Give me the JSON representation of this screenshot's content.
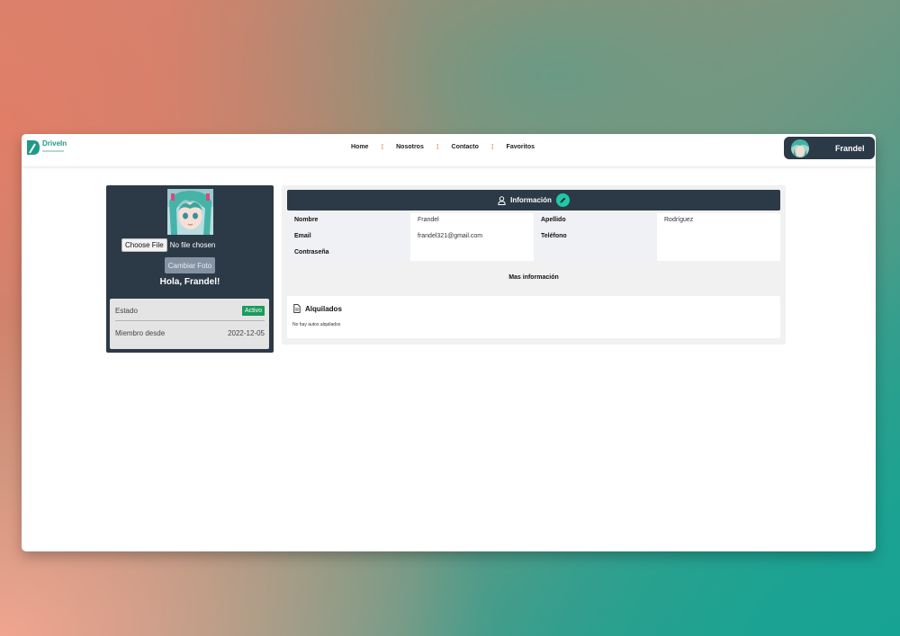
{
  "navbar": {
    "brand_name": "DriveIn",
    "links": [
      "Home",
      "Nosotros",
      "Contacto",
      "Favoritos"
    ],
    "separator": "⁞",
    "user_name": "Frandel"
  },
  "profile": {
    "file_button": "Choose File",
    "file_status": "No file chosen",
    "change_photo": "Cambiar Foto",
    "greeting": "Hola, Frandel!",
    "status_label": "Estado",
    "status_value": "Activo",
    "member_label": "Miembro desde",
    "member_value": "2022-12-05"
  },
  "info": {
    "header": "Información",
    "fields": {
      "nombre_label": "Nombre",
      "nombre_value": "Frandel",
      "email_label": "Email",
      "email_value": "frandel321@gmail.com",
      "password_label": "Contraseña",
      "apellido_label": "Apellido",
      "apellido_value": "Rodríguez",
      "telefono_label": "Teléfono"
    },
    "more_info": "Mas información"
  },
  "rented": {
    "title": "Alquilados",
    "empty": "No hay autos alquilados"
  },
  "colors": {
    "accent": "#1fc9a8",
    "dark": "#2c3a47",
    "brand": "#1f9a87",
    "badge": "#1b9b5c"
  }
}
